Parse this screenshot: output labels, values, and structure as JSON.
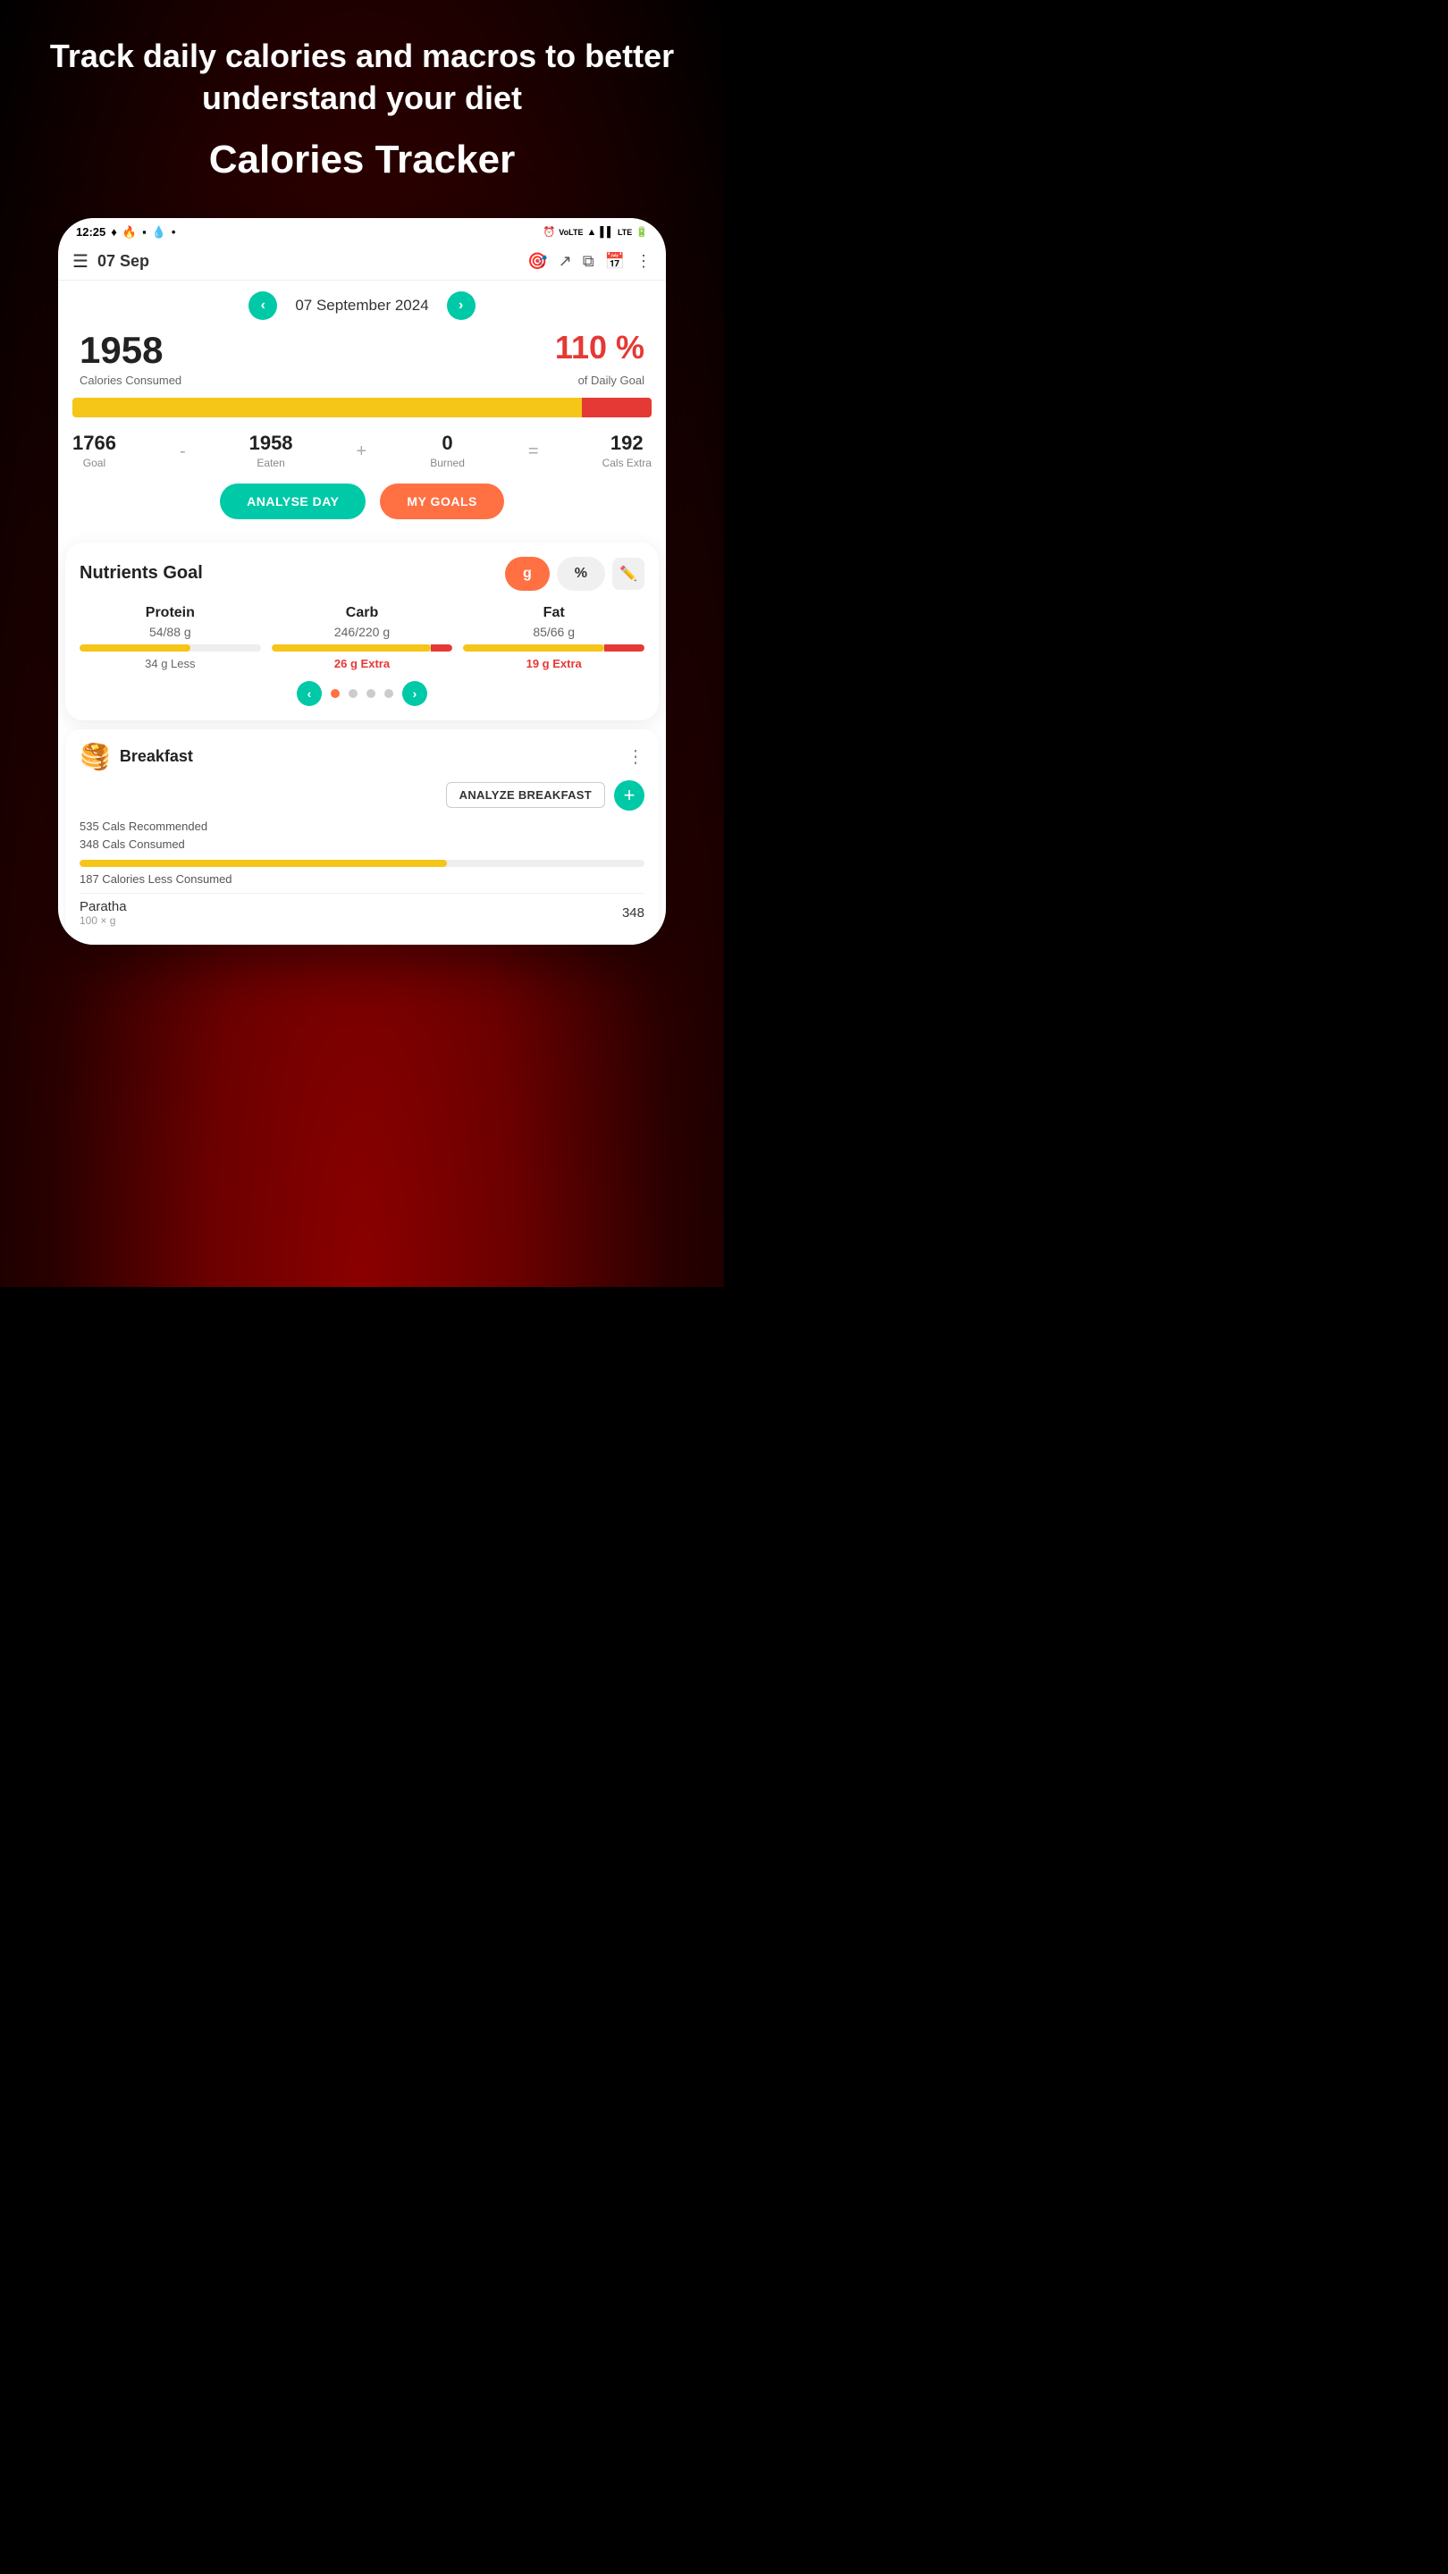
{
  "hero": {
    "subtitle": "Track daily calories and macros to better understand your diet",
    "title": "Calories Tracker"
  },
  "status_bar": {
    "time": "12:25",
    "icons_left": [
      "signal",
      "fire",
      "square",
      "drop",
      "dot"
    ],
    "icons_right": [
      "alarm",
      "lte",
      "wifi",
      "signal_bars",
      "lte2",
      "battery"
    ]
  },
  "app_header": {
    "date_short": "07 Sep",
    "icons": [
      "target",
      "share",
      "copy",
      "calendar",
      "more"
    ]
  },
  "date_nav": {
    "date_full": "07 September 2024",
    "prev_label": "‹",
    "next_label": "›"
  },
  "calories": {
    "consumed": "1958",
    "consumed_label": "Calories Consumed",
    "goal_pct": "110 %",
    "goal_pct_label": "of Daily Goal",
    "progress_yellow_pct": 88,
    "progress_red_pct": 12
  },
  "macros": {
    "goal": {
      "value": "1766",
      "label": "Goal"
    },
    "op_minus": "-",
    "eaten": {
      "value": "1958",
      "label": "Eaten"
    },
    "op_plus": "+",
    "burned": {
      "value": "0",
      "label": "Burned"
    },
    "op_equals": "=",
    "extra": {
      "value": "192",
      "label": "Cals Extra"
    }
  },
  "buttons": {
    "analyse_day": "ANALYSE DAY",
    "my_goals": "MY GOALS"
  },
  "nutrients": {
    "title": "Nutrients Goal",
    "unit_g": "g",
    "unit_pct": "%",
    "items": [
      {
        "name": "Protein",
        "amount": "54/88 g",
        "bar_fill_pct": 61,
        "bar_overflow": false,
        "status": "34 g Less",
        "status_type": "less",
        "bar_color": "#f5c518"
      },
      {
        "name": "Carb",
        "amount": "246/220 g",
        "bar_fill_pct": 100,
        "bar_overflow_pct": 12,
        "bar_overflow": true,
        "status": "26 g Extra",
        "status_type": "extra",
        "bar_color": "#f5c518"
      },
      {
        "name": "Fat",
        "amount": "85/66 g",
        "bar_fill_pct": 100,
        "bar_overflow_pct": 28,
        "bar_overflow": true,
        "status": "19 g Extra",
        "status_type": "extra",
        "bar_color": "#f5c518"
      }
    ],
    "pagination_dots": [
      true,
      false,
      false,
      false
    ]
  },
  "breakfast": {
    "icon": "🥞",
    "name": "Breakfast",
    "analyze_btn": "ANALYZE BREAKFAST",
    "cals_recommended": "535 Cals Recommended",
    "cals_consumed": "348 Cals Consumed",
    "progress_pct": 65,
    "cals_status": "187 Calories Less Consumed",
    "food_items": [
      {
        "name": "Paratha",
        "serving": "100 × g",
        "cals": "348"
      }
    ]
  }
}
